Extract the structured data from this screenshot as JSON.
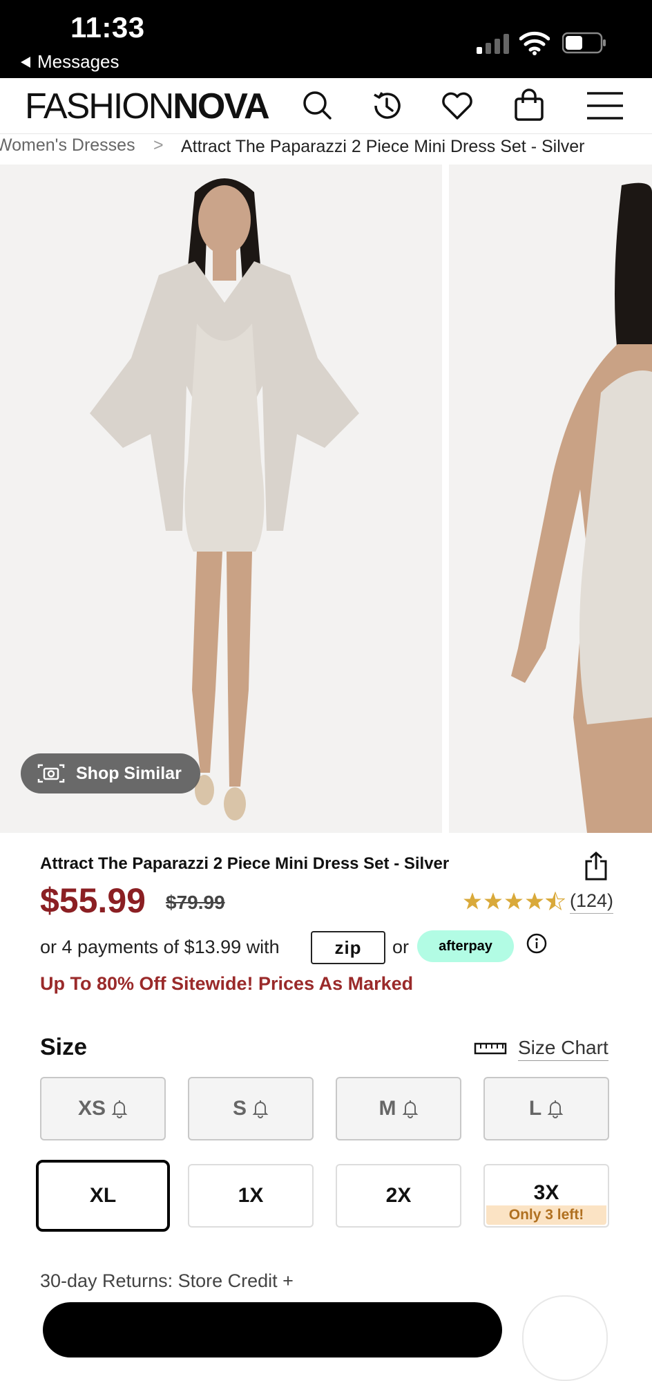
{
  "status_bar": {
    "time": "11:33",
    "back_label": "Messages"
  },
  "header": {
    "logo_light": "FASHION",
    "logo_bold": "NOVA"
  },
  "breadcrumb": {
    "previous": "Women's Dresses",
    "separator": ">",
    "current": "Attract The Paparazzi 2 Piece Mini Dress Set - Silver"
  },
  "gallery": {
    "shop_similar_label": "Shop Similar"
  },
  "product": {
    "title": "Attract The Paparazzi 2 Piece Mini Dress Set - Silver",
    "price": "$55.99",
    "original_price": "$79.99",
    "rating": 4.5,
    "reviews": "(124)",
    "installments": "or 4 payments of $13.99 with",
    "zip_label": "zip",
    "or_label": "or",
    "afterpay_label": "afterpay",
    "promo": "Up To 80% Off Sitewide! Prices As Marked",
    "price_color": "#8b1f23",
    "promo_color": "#9a2a2a"
  },
  "size": {
    "label": "Size",
    "chart_label": "Size Chart",
    "options": [
      {
        "label": "XS",
        "available": false
      },
      {
        "label": "S",
        "available": false
      },
      {
        "label": "M",
        "available": false
      },
      {
        "label": "L",
        "available": false
      },
      {
        "label": "XL",
        "available": true,
        "selected": true
      },
      {
        "label": "1X",
        "available": true
      },
      {
        "label": "2X",
        "available": true
      },
      {
        "label": "3X",
        "available": true,
        "note": "Only 3 left!"
      }
    ]
  },
  "returns": "30-day Returns: Store Credit +",
  "icons": [
    "search-icon",
    "history-icon",
    "heart-icon",
    "bag-icon",
    "menu-icon",
    "camera-icon",
    "share-icon",
    "info-icon",
    "ruler-icon",
    "bell-icon"
  ]
}
